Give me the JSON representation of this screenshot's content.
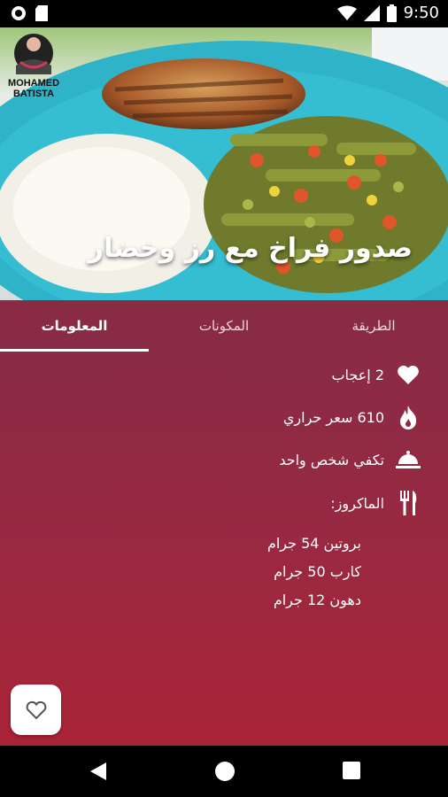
{
  "status_bar": {
    "time": "9:50",
    "icons": [
      "camera-icon",
      "sd-card-icon",
      "wifi-icon",
      "signal-icon",
      "battery-icon"
    ]
  },
  "hero": {
    "title": "صدور فراخ مع رز وخضار",
    "logo_text_line1": "MOHAMED",
    "logo_text_line2": "BATISTA"
  },
  "tabs": [
    {
      "label": "المعلومات",
      "active": true
    },
    {
      "label": "المكونات",
      "active": false
    },
    {
      "label": "الطريقة",
      "active": false
    }
  ],
  "info": {
    "likes": "2 إعجاب",
    "calories": "610 سعر حراري",
    "servings": "تكفي شخص واحد",
    "macros_label": "الماكروز:",
    "macros": [
      "بروتين 54 جرام",
      "كارب 50 جرام",
      "دهون 12 جرام"
    ]
  },
  "colors": {
    "primary": "#8a2b45",
    "primary_dark": "#aa2437",
    "on_primary": "#ffffff"
  }
}
